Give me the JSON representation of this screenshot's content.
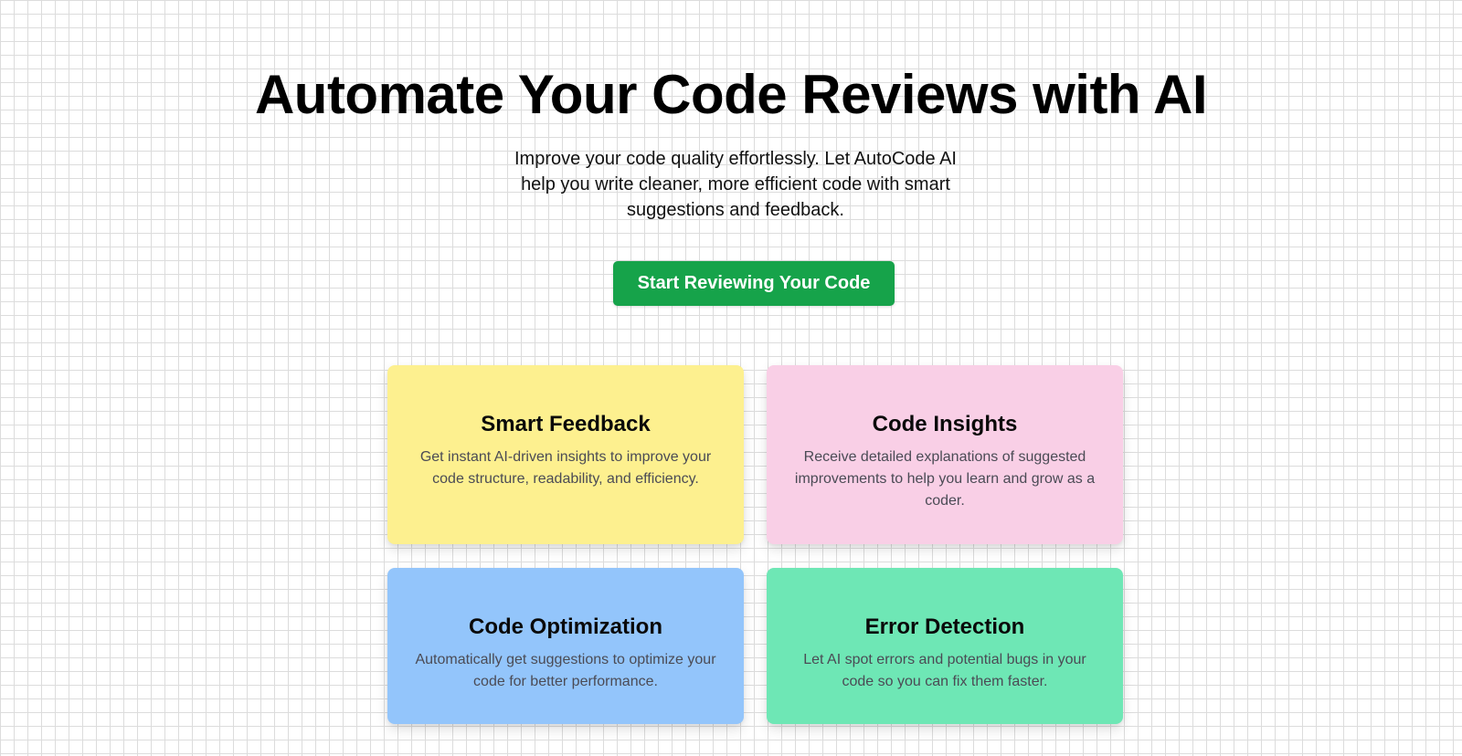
{
  "hero": {
    "title": "Automate Your Code Reviews with AI",
    "subtitle": "Improve your code quality effortlessly. Let AutoCode AI help you write cleaner, more efficient code with smart suggestions and feedback.",
    "cta_label": "Start Reviewing Your Code"
  },
  "features": [
    {
      "title": "Smart Feedback",
      "description": "Get instant AI-driven insights to improve your code structure, readability, and efficiency.",
      "color": "#fdf08f"
    },
    {
      "title": "Code Insights",
      "description": "Receive detailed explanations of suggested improvements to help you learn and grow as a coder.",
      "color": "#f9cfe6"
    },
    {
      "title": "Code Optimization",
      "description": "Automatically get suggestions to optimize your code for better performance.",
      "color": "#93c5fb"
    },
    {
      "title": "Error Detection",
      "description": "Let AI spot errors and potential bugs in your code so you can fix them faster.",
      "color": "#6ee7b5"
    }
  ],
  "colors": {
    "cta": "#16a34a",
    "grid": "#dcdcdc"
  }
}
